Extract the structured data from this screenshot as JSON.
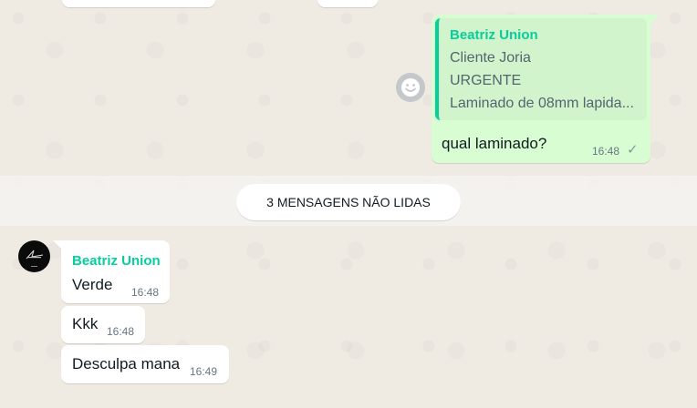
{
  "quoted_message": {
    "author": "Beatriz Union",
    "lines": [
      "Cliente Joria",
      "URGENTE",
      "Laminado de 08mm lapida..."
    ]
  },
  "outgoing_message": {
    "text": "qual laminado?",
    "time": "16:48",
    "status_icon": "single-check-icon"
  },
  "emoji_button": {
    "icon": "smiley-icon"
  },
  "unread_banner": {
    "label": "3 MENSAGENS NÃO LIDAS"
  },
  "incoming_group": {
    "sender": "Beatriz Union",
    "avatar_icon": "contact-avatar",
    "messages": [
      {
        "text": "Verde",
        "time": "16:48"
      },
      {
        "text": "Kkk",
        "time": "16:48"
      },
      {
        "text": "Desculpa mana",
        "time": "16:49"
      }
    ]
  },
  "colors": {
    "background": "#efeae2",
    "outgoing_bubble": "#d9fdd3",
    "incoming_bubble": "#ffffff",
    "accent": "#06cf9c"
  }
}
